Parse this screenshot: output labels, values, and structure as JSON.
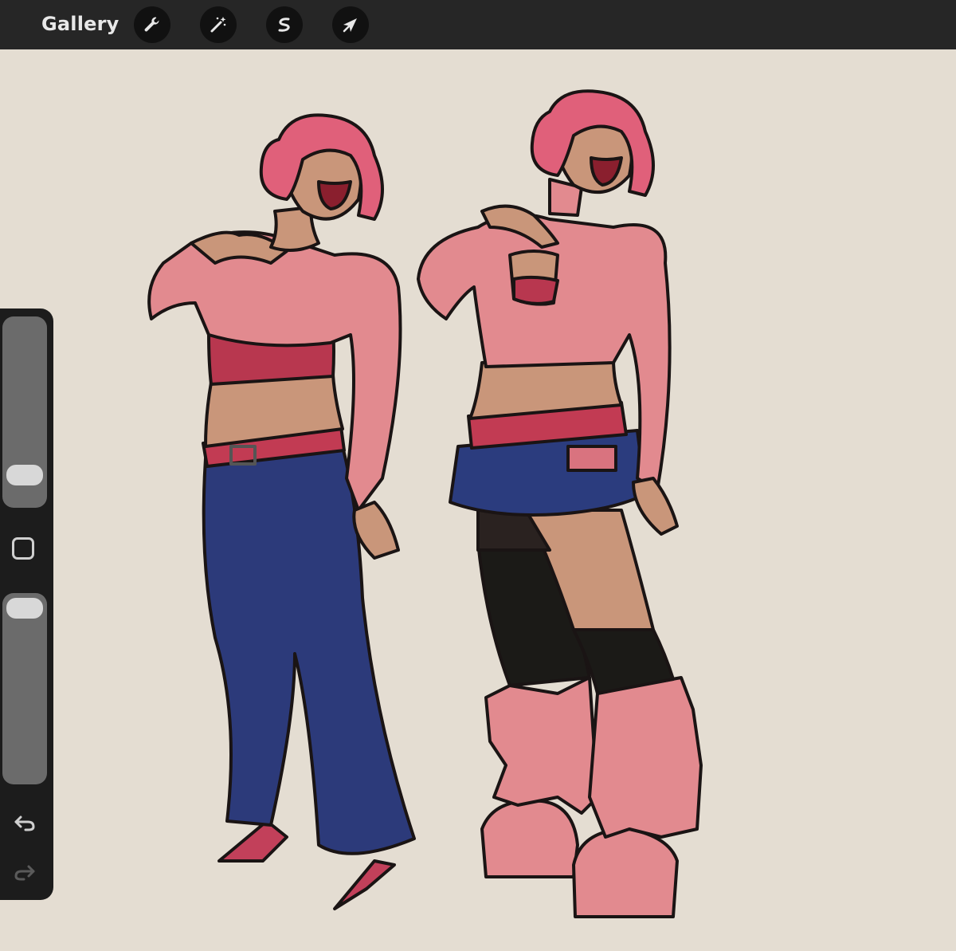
{
  "topbar": {
    "gallery_label": "Gallery",
    "tools": [
      {
        "name": "actions-wrench-icon"
      },
      {
        "name": "adjustments-wand-icon"
      },
      {
        "name": "selection-s-icon"
      },
      {
        "name": "transform-arrow-icon"
      }
    ]
  },
  "sidebar": {
    "brush_size_level": 0.78,
    "opacity_level": 0.05,
    "icons": [
      "modify-square-icon",
      "undo-icon",
      "redo-icon"
    ]
  },
  "canvas": {
    "background_color": "#e4ddd2",
    "content": "character-sheet-artwork"
  },
  "colors": {
    "topbar": "#262626",
    "sidebar": "#1c1c1c",
    "slider_track": "#6b6b6b",
    "skin": "#c9967a",
    "pink": "#e28a8f",
    "jeans": "#2c3a7a"
  }
}
